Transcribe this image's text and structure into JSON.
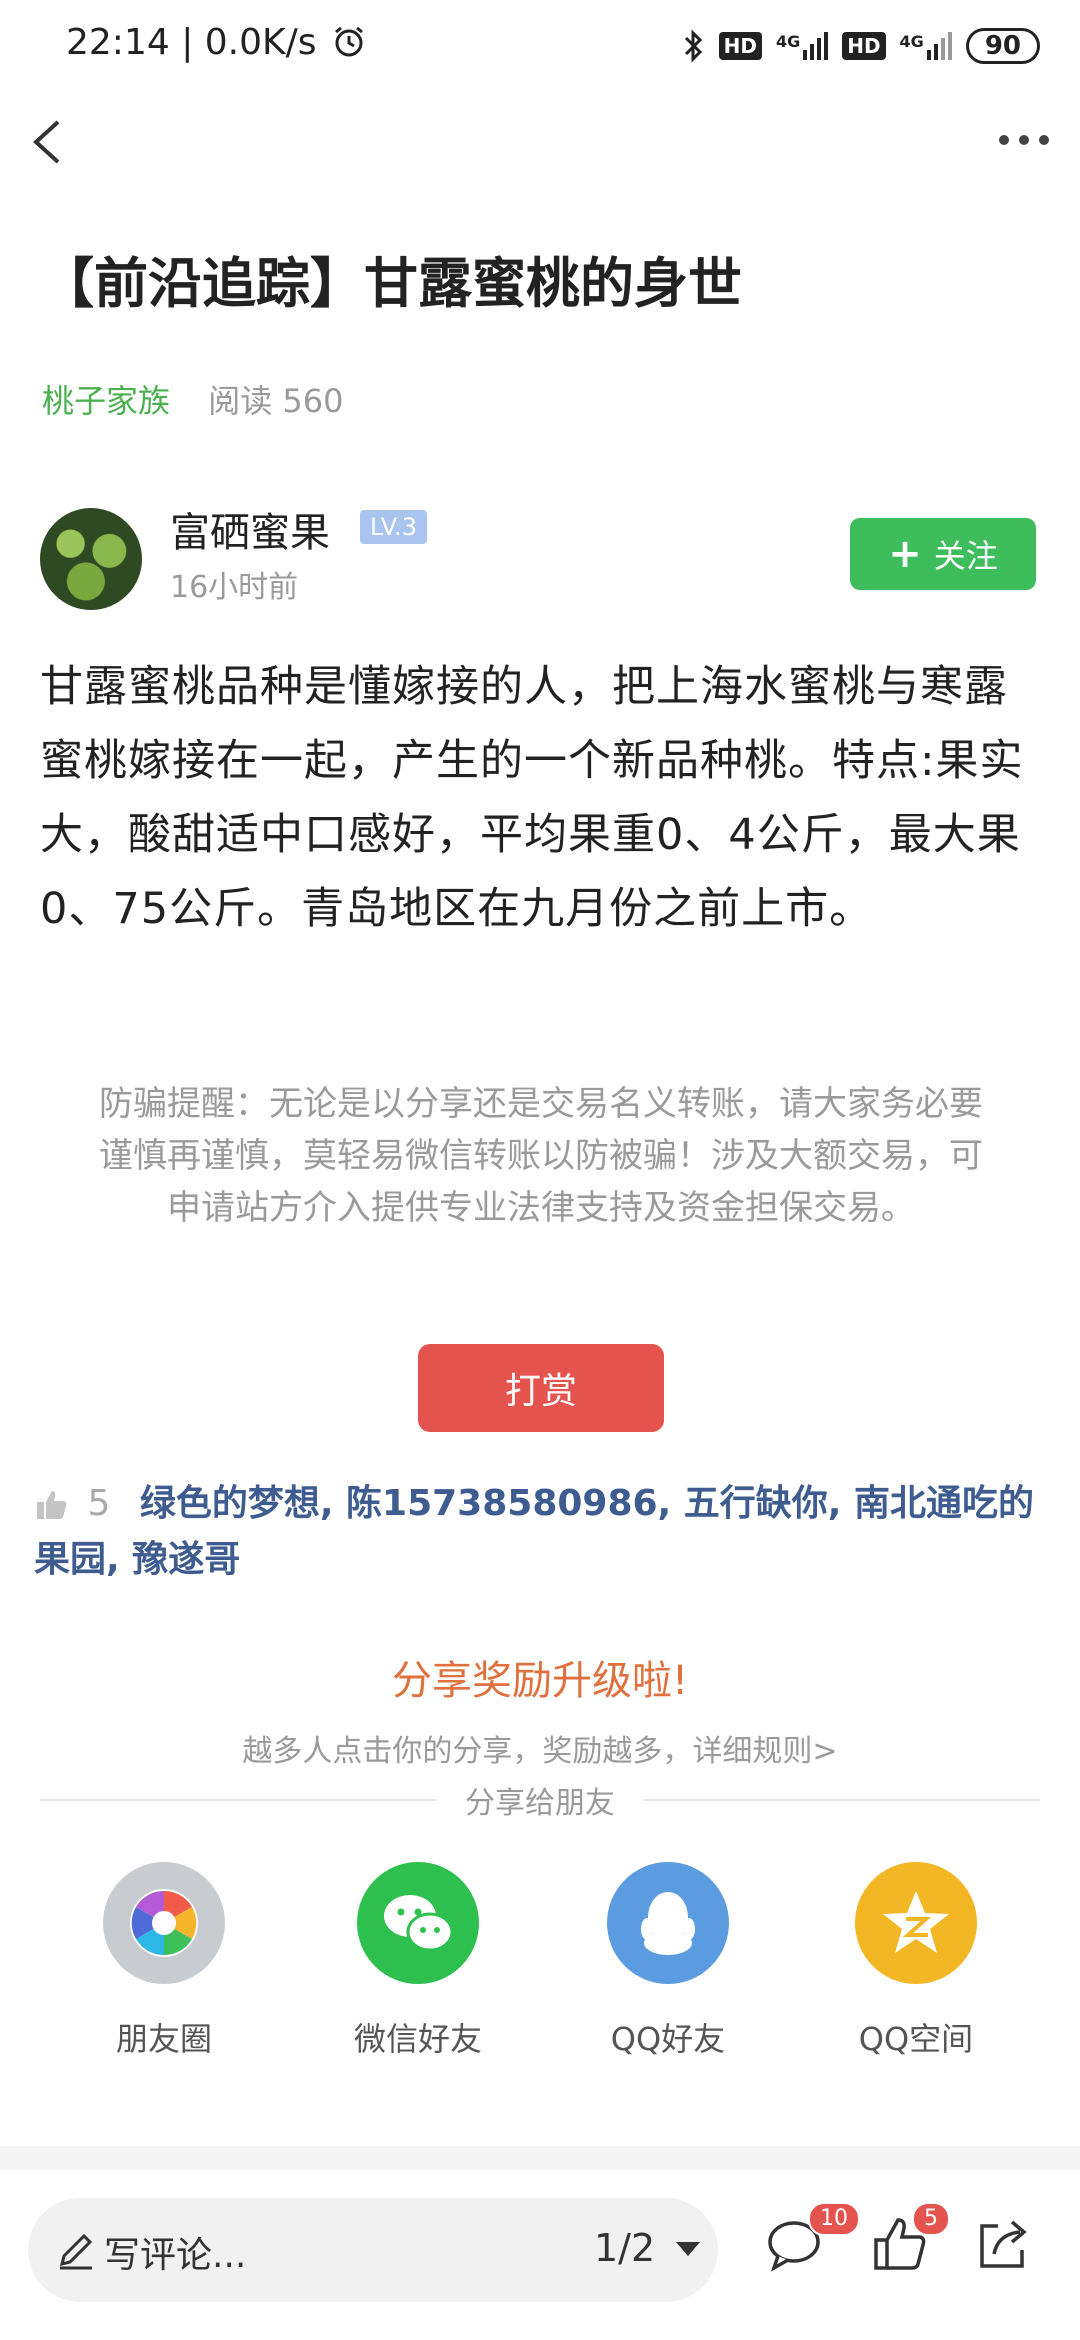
{
  "status_bar": {
    "time_speed": "22:14 | 0.0K/s",
    "alarm_icon": "alarm-icon",
    "bluetooth_icon": "bluetooth-icon",
    "hd1": "HD",
    "net1": "4G",
    "hd2": "HD",
    "net2": "4G",
    "battery": "90"
  },
  "nav": {
    "back_icon": "chevron-left-icon",
    "more_icon": "more-dots-icon"
  },
  "article": {
    "title": "【前沿追踪】甘露蜜桃的身世",
    "category": "桃子家族",
    "reads": "阅读 560",
    "author": {
      "name": "富硒蜜果",
      "level": "LV.3",
      "time": "16小时前"
    },
    "follow_label": "关注",
    "body": "甘露蜜桃品种是懂嫁接的人，把上海水蜜桃与寒露蜜桃嫁接在一起，产生的一个新品种桃。特点:果实大，酸甜适中口感好，平均果重0、4公斤，最大果0、75公斤。青岛地区在九月份之前上市。",
    "warning": "防骗提醒：无论是以分享还是交易名义转账，请大家务必要谨慎再谨慎，莫轻易微信转账以防被骗！涉及大额交易，可申请站方介入提供专业法律支持及资金担保交易。",
    "reward_label": "打赏"
  },
  "likes": {
    "count": "5",
    "names": "绿色的梦想, 陈15738580986, 五行缺你, 南北通吃的果园, 豫遂哥"
  },
  "share": {
    "title": "分享奖励升级啦!",
    "subtitle": "越多人点击你的分享，奖励越多，详细规则>",
    "divider_label": "分享给朋友",
    "targets": [
      {
        "label": "朋友圈",
        "icon": "moments-icon",
        "color": "#c8ccd0"
      },
      {
        "label": "微信好友",
        "icon": "wechat-icon",
        "color": "#2dc04f"
      },
      {
        "label": "QQ好友",
        "icon": "qq-icon",
        "color": "#5b9be0"
      },
      {
        "label": "QQ空间",
        "icon": "qzone-icon",
        "color": "#f3b625"
      }
    ]
  },
  "footer": {
    "comment_placeholder": "写评论...",
    "page_indicator": "1/2",
    "comment_count": "10",
    "like_count": "5"
  }
}
